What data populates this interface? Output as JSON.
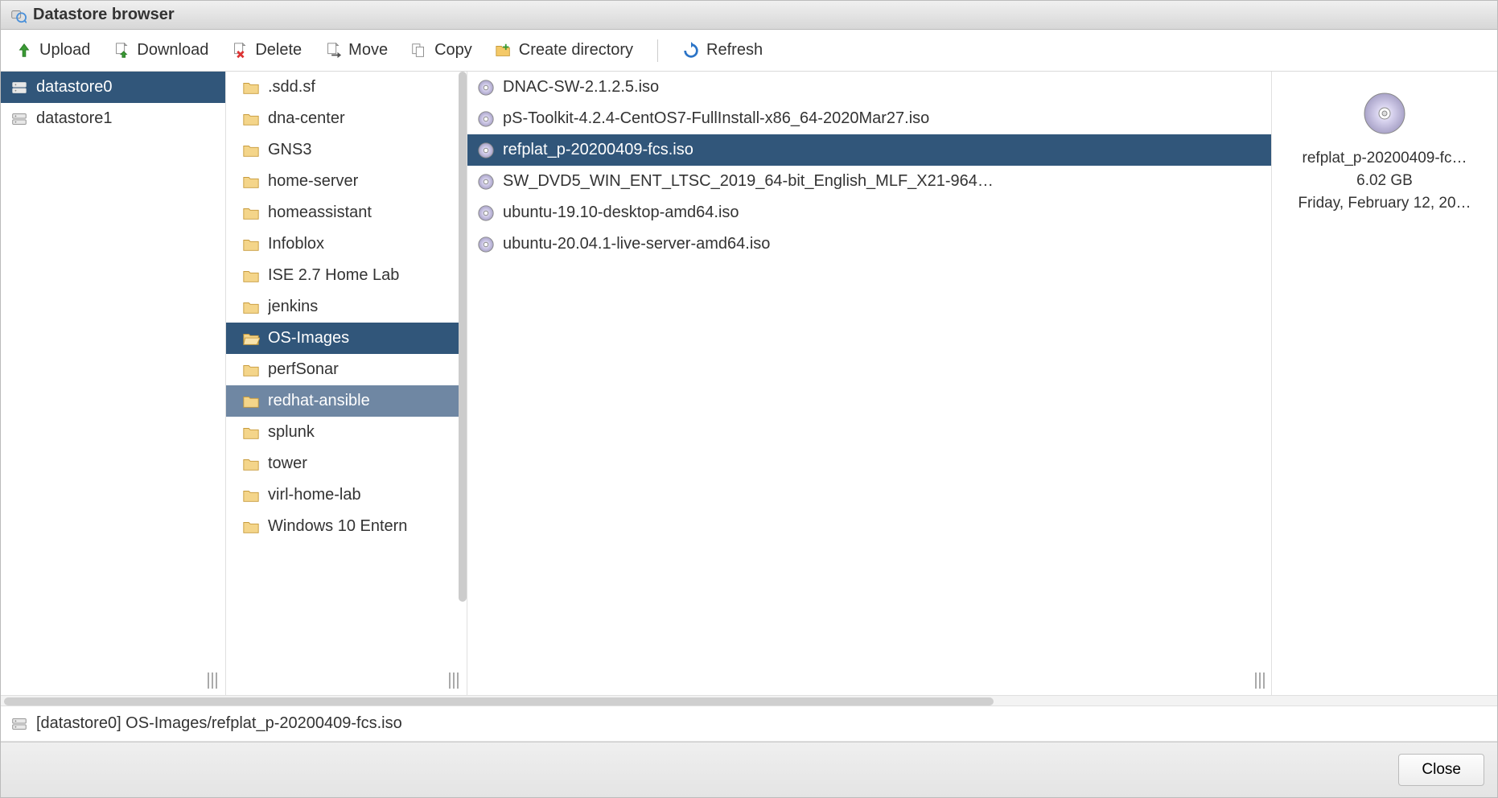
{
  "window": {
    "title": "Datastore browser"
  },
  "toolbar": {
    "upload": "Upload",
    "download": "Download",
    "delete": "Delete",
    "move": "Move",
    "copy": "Copy",
    "create_dir": "Create directory",
    "refresh": "Refresh"
  },
  "datastores": [
    {
      "name": "datastore0",
      "selected": true
    },
    {
      "name": "datastore1",
      "selected": false
    }
  ],
  "folders": [
    {
      "name": ".sdd.sf"
    },
    {
      "name": "dna-center"
    },
    {
      "name": "GNS3"
    },
    {
      "name": "home-server"
    },
    {
      "name": "homeassistant"
    },
    {
      "name": "Infoblox"
    },
    {
      "name": "ISE 2.7 Home Lab"
    },
    {
      "name": "jenkins"
    },
    {
      "name": "OS-Images",
      "selected": true
    },
    {
      "name": "perfSonar"
    },
    {
      "name": "redhat-ansible",
      "hover": true
    },
    {
      "name": "splunk"
    },
    {
      "name": "tower"
    },
    {
      "name": "virl-home-lab"
    },
    {
      "name": "Windows 10 Entern"
    }
  ],
  "files": [
    {
      "name": "DNAC-SW-2.1.2.5.iso"
    },
    {
      "name": "pS-Toolkit-4.2.4-CentOS7-FullInstall-x86_64-2020Mar27.iso"
    },
    {
      "name": "refplat_p-20200409-fcs.iso",
      "selected": true
    },
    {
      "name": "SW_DVD5_WIN_ENT_LTSC_2019_64-bit_English_MLF_X21-964…"
    },
    {
      "name": "ubuntu-19.10-desktop-amd64.iso"
    },
    {
      "name": "ubuntu-20.04.1-live-server-amd64.iso"
    }
  ],
  "details": {
    "name": "refplat_p-20200409-fc…",
    "size": "6.02 GB",
    "date": "Friday, February 12, 20…"
  },
  "path": "[datastore0] OS-Images/refplat_p-20200409-fcs.iso",
  "footer": {
    "close": "Close"
  }
}
